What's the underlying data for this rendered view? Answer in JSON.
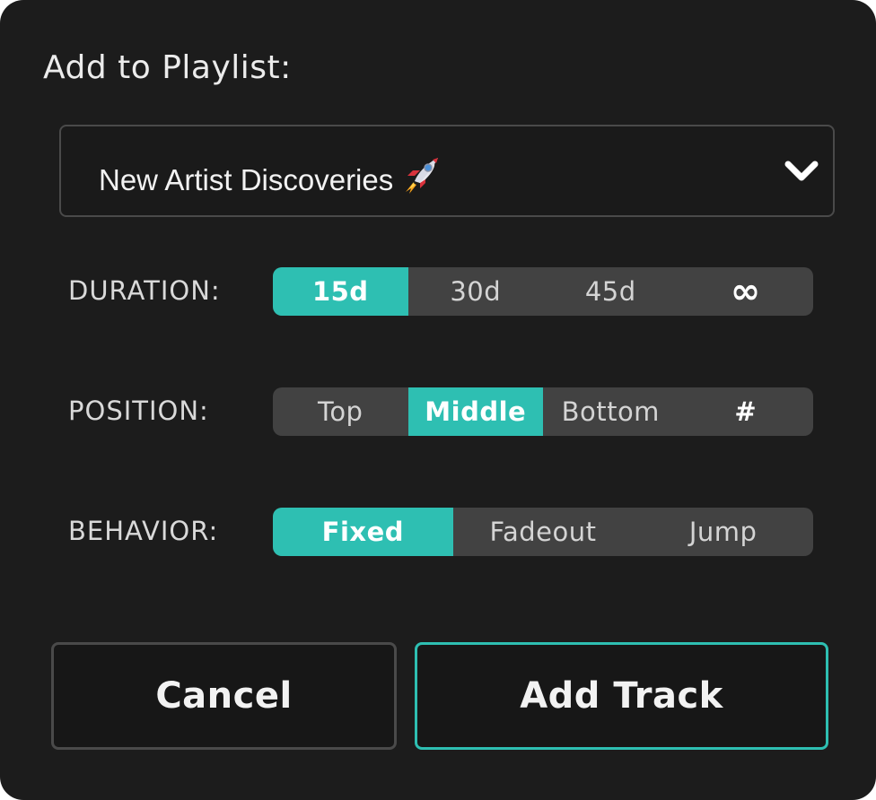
{
  "dialog": {
    "title": "Add to Playlist:",
    "playlist_select": {
      "value": "New Artist Discoveries",
      "emoji_icon": "rocket-icon",
      "dropdown_icon": "chevron-down-icon"
    },
    "duration": {
      "label": "DURATION:",
      "options": [
        "15d",
        "30d",
        "45d",
        "∞"
      ],
      "selected": "15d"
    },
    "position": {
      "label": "POSITION:",
      "options": [
        "Top",
        "Middle",
        "Bottom",
        "#"
      ],
      "selected": "Middle"
    },
    "behavior": {
      "label": "BEHAVIOR:",
      "options": [
        "Fixed",
        "Fadeout",
        "Jump"
      ],
      "selected": "Fixed"
    },
    "buttons": {
      "cancel": "Cancel",
      "add": "Add Track"
    }
  },
  "colors": {
    "background": "#1c1c1c",
    "accent": "#2ebfb2",
    "segment_bg": "#424242",
    "border": "#4a4a4a",
    "text": "#ececec"
  }
}
